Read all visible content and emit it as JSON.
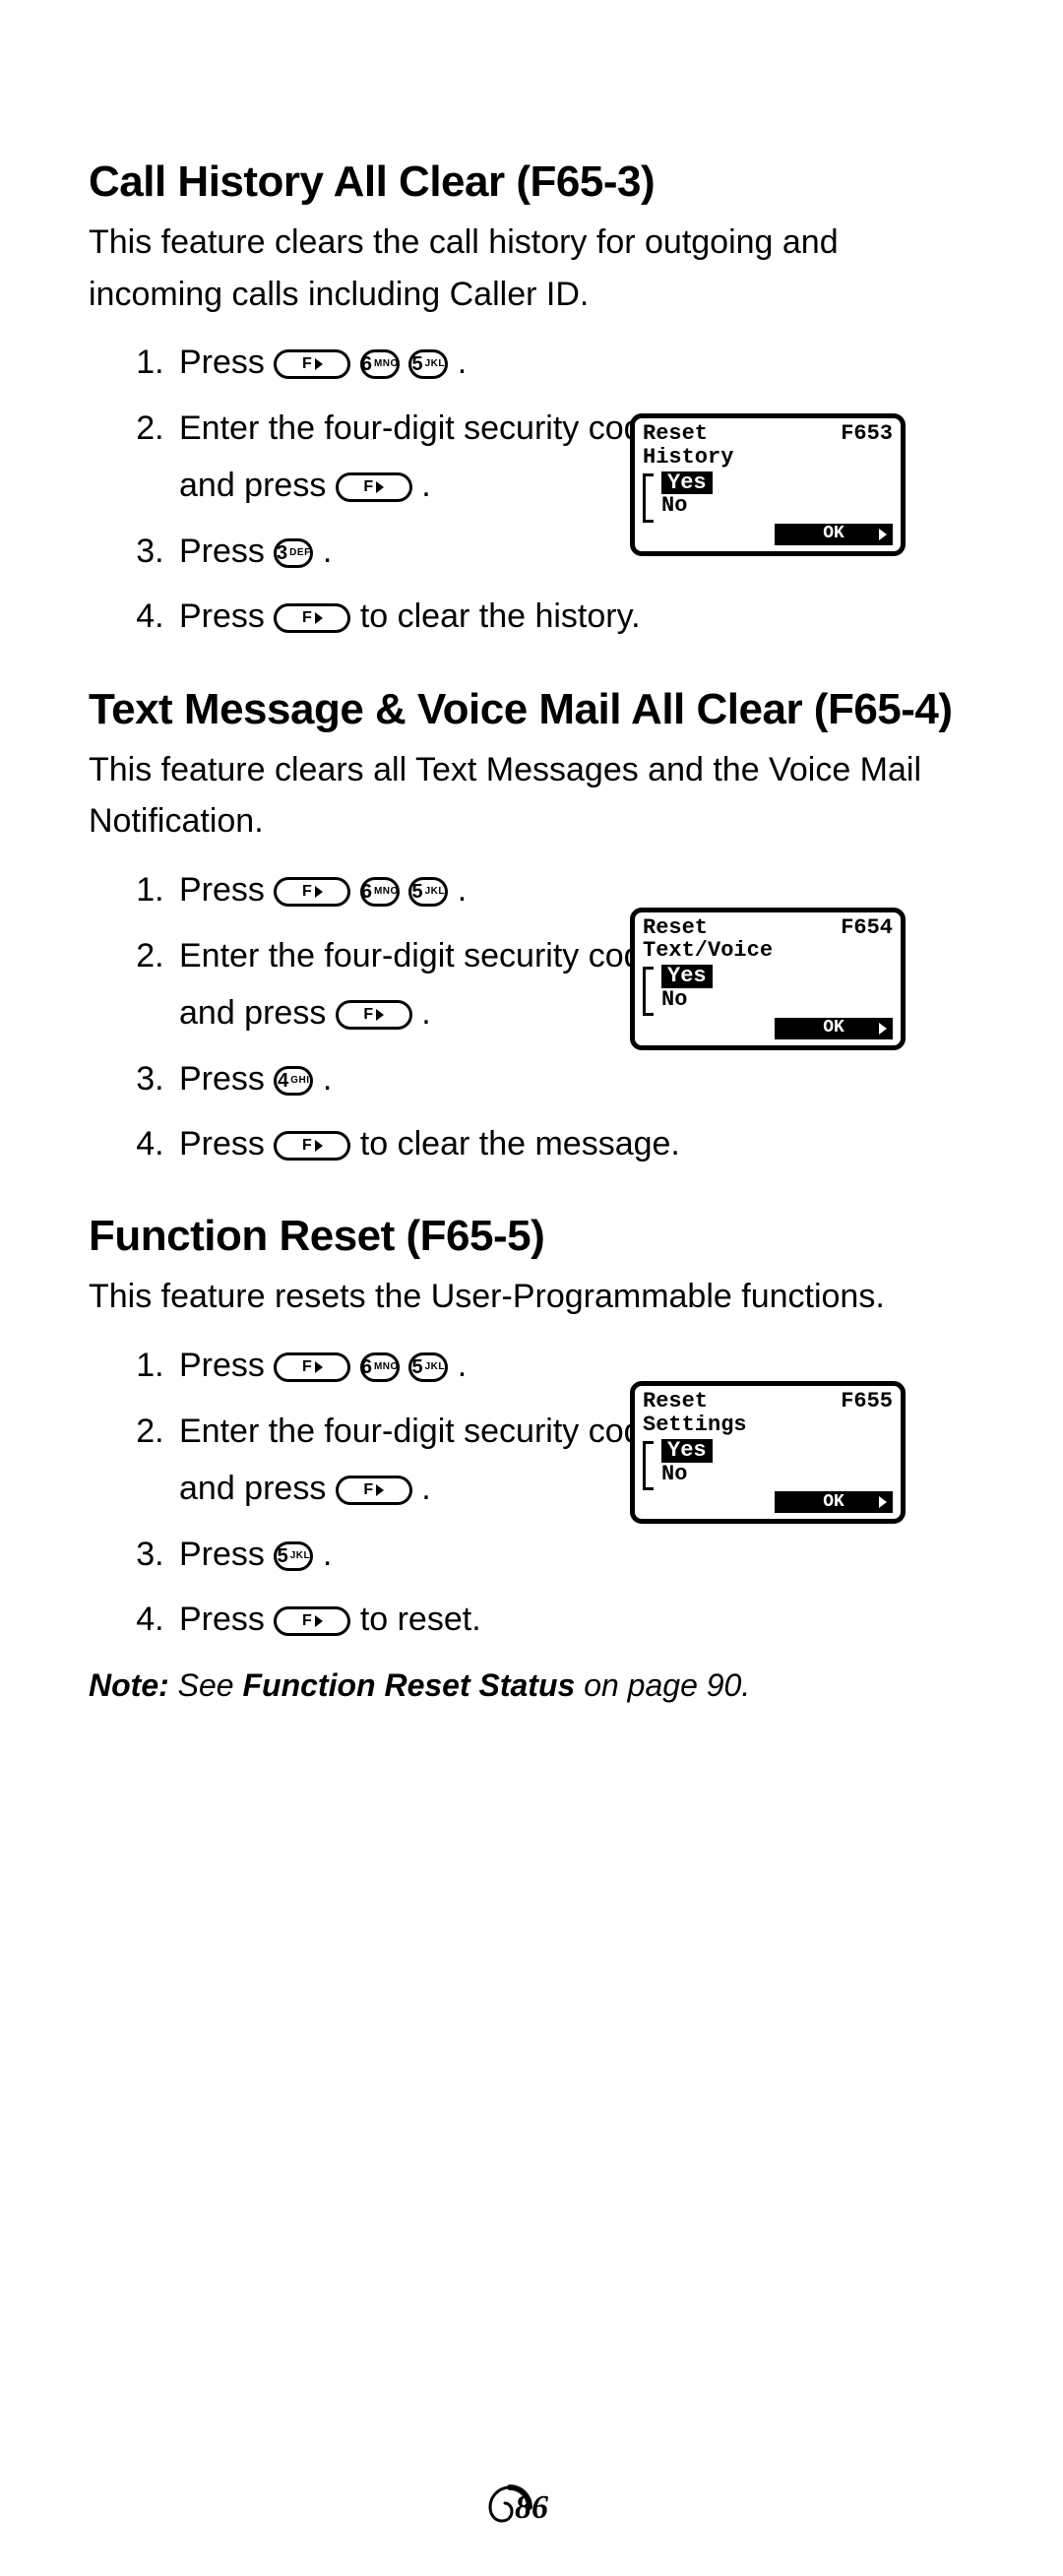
{
  "page_number": "86",
  "note": {
    "prefix": "Note:",
    "mid1": "  See ",
    "bold": "Function Reset Status",
    "mid2": " on page 90."
  },
  "keys": {
    "F": "F",
    "3": {
      "n": "3",
      "sub": "DEF"
    },
    "4": {
      "n": "4",
      "sub": "GHI"
    },
    "5": {
      "n": "5",
      "sub": "JKL"
    },
    "6": {
      "n": "6",
      "sub": "MNO"
    }
  },
  "lcd_common": {
    "reset": "Reset",
    "yes": "Yes",
    "no": "No",
    "ok": "OK"
  },
  "sections": [
    {
      "id": "s1",
      "title": "Call History All Clear (F65-3)",
      "intro": "This feature clears the call history for outgoing and incoming calls including Caller ID.",
      "step1a": "Press ",
      "step1b": ".",
      "step2a": "Enter the four-digit security code  and press ",
      "step2b": ".",
      "step3a": "Press ",
      "step3b": ".",
      "step4a": "Press ",
      "step4b": " to clear the history.",
      "step3key": "3",
      "lcd": {
        "code": "F653",
        "line2": "History"
      }
    },
    {
      "id": "s2",
      "title": "Text Message & Voice Mail All Clear (F65-4)",
      "intro": "This feature clears all Text Messages and the Voice Mail Notification.",
      "step1a": "Press ",
      "step1b": ".",
      "step2a": "Enter the four-digit security code and press ",
      "step2b": ".",
      "step3a": "Press ",
      "step3b": ".",
      "step4a": "Press ",
      "step4b": " to clear the message.",
      "step3key": "4",
      "lcd": {
        "code": "F654",
        "line2": "Text/Voice"
      }
    },
    {
      "id": "s3",
      "title": "Function Reset (F65-5)",
      "intro": "This feature resets the User-Programmable functions.",
      "step1a": "Press ",
      "step1b": ".",
      "step2a": "Enter the four-digit security code and press ",
      "step2b": ".",
      "step3a": "Press ",
      "step3b": ".",
      "step4a": "Press ",
      "step4b": " to reset.",
      "step3key": "5",
      "lcd": {
        "code": "F655",
        "line2": "Settings"
      }
    }
  ]
}
